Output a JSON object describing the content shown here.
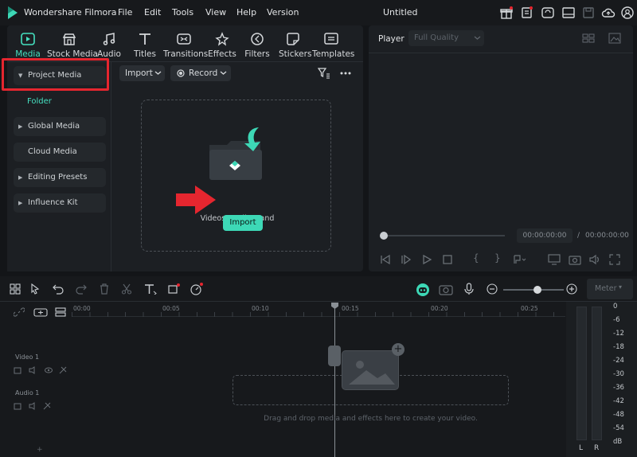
{
  "app": {
    "name": "Wondershare Filmora",
    "document_title": "Untitled",
    "menu": [
      "File",
      "Edit",
      "Tools",
      "View",
      "Help",
      "Version"
    ]
  },
  "tool_tabs": [
    {
      "label": "Media",
      "icon": "media-icon",
      "active": true
    },
    {
      "label": "Stock Media",
      "icon": "stock-media-icon"
    },
    {
      "label": "Audio",
      "icon": "audio-icon"
    },
    {
      "label": "Titles",
      "icon": "titles-icon"
    },
    {
      "label": "Transitions",
      "icon": "transitions-icon"
    },
    {
      "label": "Effects",
      "icon": "effects-icon"
    },
    {
      "label": "Filters",
      "icon": "filters-icon"
    },
    {
      "label": "Stickers",
      "icon": "stickers-icon"
    },
    {
      "label": "Templates",
      "icon": "templates-icon"
    }
  ],
  "sidebar": {
    "project_media": "Project Media",
    "folder": "Folder",
    "global_media": "Global Media",
    "cloud_media": "Cloud Media",
    "editing_presets": "Editing Presets",
    "influence_kit": "Influence Kit"
  },
  "media_toolbar": {
    "import_label": "Import",
    "record_label": "Record"
  },
  "drop_zone": {
    "import_button": "Import",
    "hint": "Videos, audios, and images"
  },
  "player": {
    "title": "Player",
    "quality": "Full Quality",
    "current_time": "00:00:00:00",
    "separator": "/",
    "total_time": "00:00:00:00"
  },
  "timeline": {
    "ruler_labels": [
      "00:00",
      "00:05",
      "00:10",
      "00:15",
      "00:20",
      "00:25"
    ],
    "tracks": [
      "Video 1",
      "Audio 1"
    ],
    "drop_hint": "Drag and drop media and effects here to create your video.",
    "meter_label": "Meter",
    "meter_scale": [
      "0",
      "-6",
      "-12",
      "-18",
      "-24",
      "-30",
      "-36",
      "-42",
      "-48",
      "-54",
      "dB"
    ],
    "meter_channels": [
      "L",
      "R"
    ]
  },
  "colors": {
    "accent": "#45e0c0",
    "highlight_red": "#e5262f",
    "background": "#131518"
  }
}
